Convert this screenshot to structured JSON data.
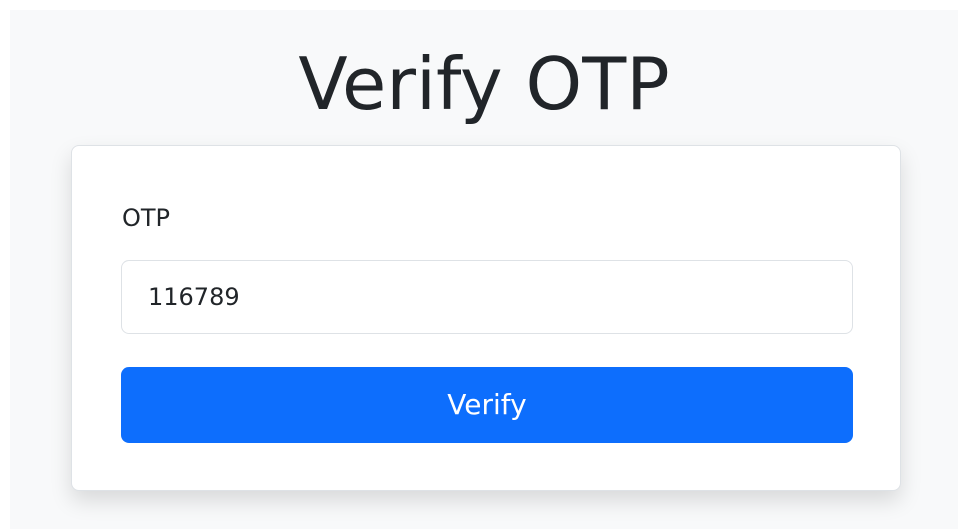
{
  "page": {
    "title": "Verify OTP"
  },
  "form": {
    "otp_label": "OTP",
    "otp_value": "116789",
    "verify_label": "Verify"
  },
  "colors": {
    "background": "#f8f9fa",
    "card": "#ffffff",
    "primary": "#0d6efd",
    "text": "#212529",
    "border": "#dee2e6"
  }
}
